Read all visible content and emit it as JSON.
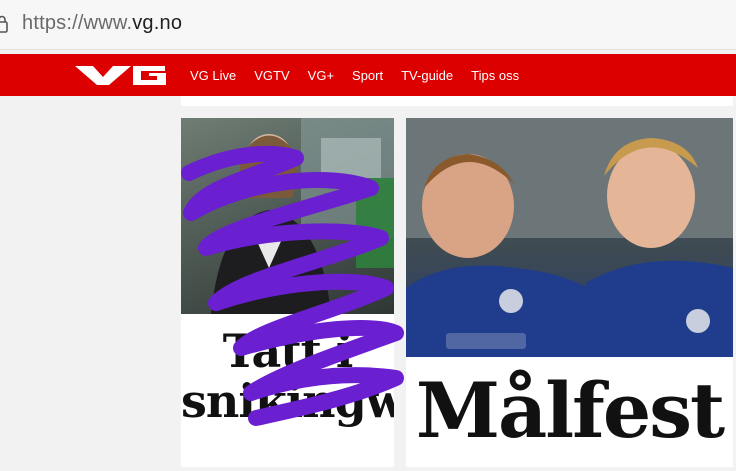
{
  "browser": {
    "url_scheme": "https://www.",
    "url_host": "vg.no"
  },
  "header": {
    "logo_text": "VG",
    "nav": [
      "VG Live",
      "VGTV",
      "VG+",
      "Sport",
      "TV-guide",
      "Tips oss"
    ]
  },
  "articles": [
    {
      "headline": "Tatt i snikingw"
    },
    {
      "headline": "Målfest"
    }
  ],
  "colors": {
    "brand_red": "#dd0000",
    "scribble": "#6a1fd1"
  }
}
